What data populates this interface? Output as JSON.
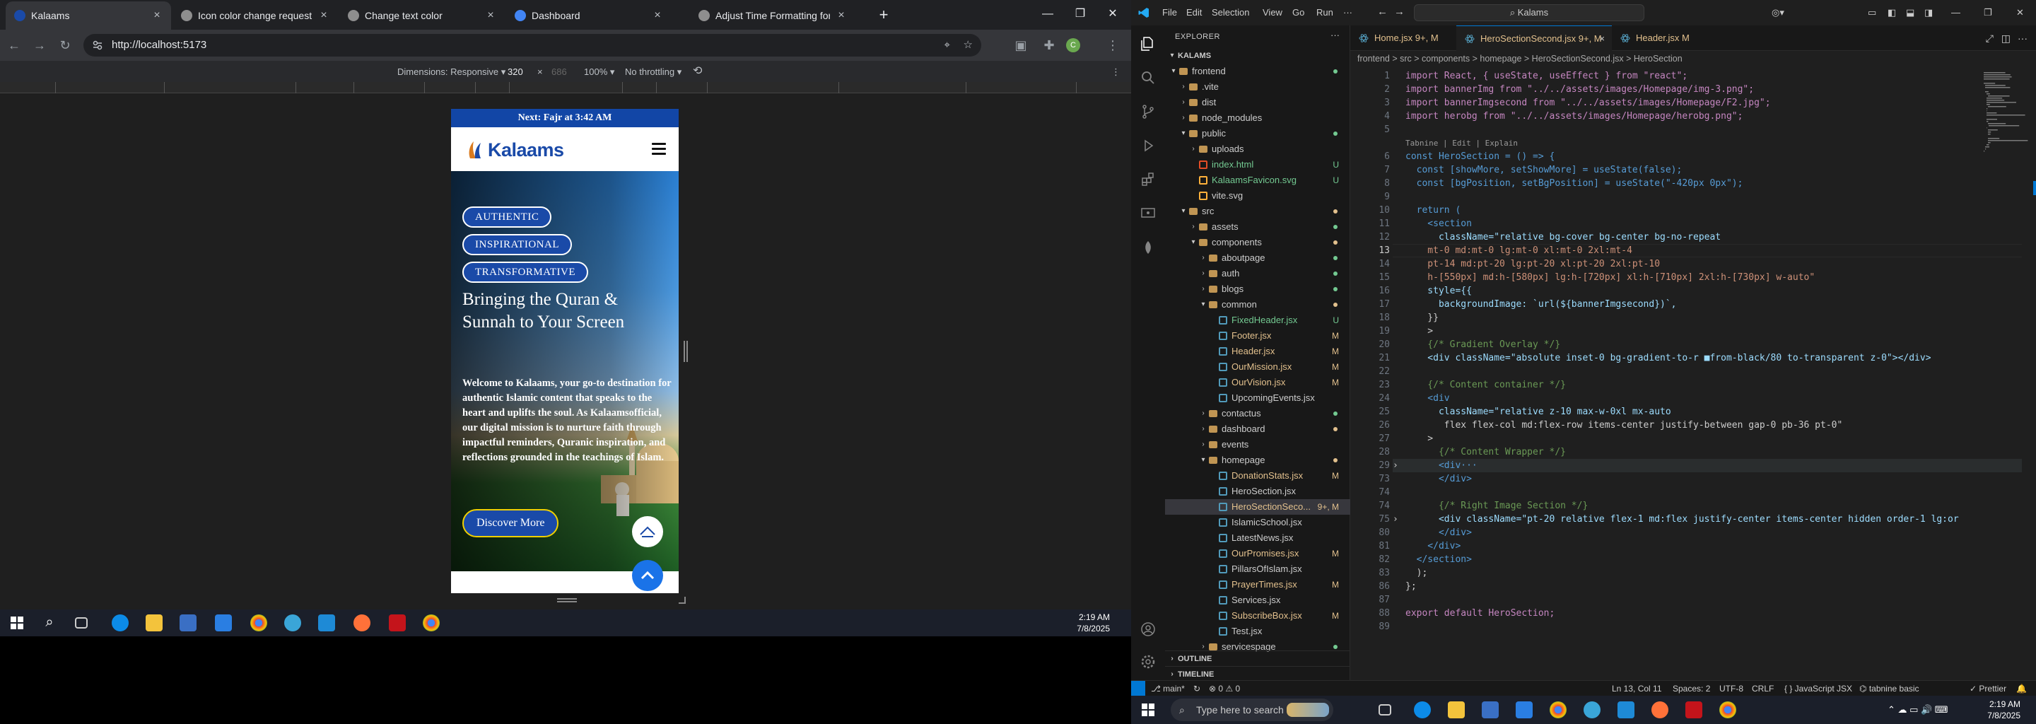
{
  "browser": {
    "tabs": [
      {
        "label": "Kalaams",
        "color": "#1a4aa8"
      },
      {
        "label": "Icon color change request",
        "color": "#8e8e8e"
      },
      {
        "label": "Change text color",
        "color": "#8e8e8e"
      },
      {
        "label": "Dashboard",
        "color": "#4285f4"
      },
      {
        "label": "Adjust Time Formatting for AM",
        "color": "#8e8e8e"
      }
    ],
    "new_tab": "+",
    "url": "http://localhost:5173",
    "devtools": {
      "dimensions_label": "Dimensions: Responsive",
      "width": "320",
      "times": "×",
      "height": "686",
      "zoom": "100%",
      "throttle": "No throttling"
    }
  },
  "site": {
    "prayer_bar": "Next: Fajr at 3:42 AM",
    "logo_text": "Kalaams",
    "pills": [
      "AUTHENTIC",
      "INSPIRATIONAL",
      "TRANSFORMATIVE"
    ],
    "title_line1": "Bringing the Quran &",
    "title_line2": "Sunnah to Your Screen",
    "body": "Welcome to Kalaams, your go-to destination for authentic Islamic content that speaks to the heart and uplifts the soul. As Kalaamsofficial, our digital mission is to nurture faith through impactful reminders, Quranic inspiration, and reflections grounded in the teachings of Islam.",
    "cta": "Discover More"
  },
  "left_clock": {
    "time": "2:19 AM",
    "date": "7/8/2025"
  },
  "vscode": {
    "menu": [
      "File",
      "Edit",
      "Selection",
      "View",
      "Go",
      "Run",
      "···"
    ],
    "search": "Kalams",
    "explorer_title": "EXPLORER",
    "root": "KALAMS",
    "tree": [
      {
        "d": 1,
        "t": "folder",
        "open": true,
        "name": "frontend",
        "dot": "#73c991"
      },
      {
        "d": 2,
        "t": "folder",
        "open": false,
        "name": ".vite"
      },
      {
        "d": 2,
        "t": "folder",
        "open": false,
        "name": "dist"
      },
      {
        "d": 2,
        "t": "folder",
        "open": false,
        "name": "node_modules"
      },
      {
        "d": 2,
        "t": "folder",
        "open": true,
        "name": "public",
        "dot": "#73c991"
      },
      {
        "d": 3,
        "t": "folder",
        "open": false,
        "name": "uploads"
      },
      {
        "d": 3,
        "t": "file",
        "c": "#e44d26",
        "name": "index.html",
        "st": "U"
      },
      {
        "d": 3,
        "t": "file",
        "c": "#ffb13b",
        "name": "KalaamsFavicon.svg",
        "st": "U"
      },
      {
        "d": 3,
        "t": "file",
        "c": "#ffb13b",
        "name": "vite.svg"
      },
      {
        "d": 2,
        "t": "folder",
        "open": true,
        "name": "src",
        "dot": "#e2c08d"
      },
      {
        "d": 3,
        "t": "folder",
        "open": false,
        "name": "assets",
        "dot": "#73c991"
      },
      {
        "d": 3,
        "t": "folder",
        "open": true,
        "name": "components",
        "dot": "#e2c08d"
      },
      {
        "d": 4,
        "t": "folder",
        "open": false,
        "name": "aboutpage",
        "dot": "#73c991"
      },
      {
        "d": 4,
        "t": "folder",
        "open": false,
        "name": "auth",
        "dot": "#73c991"
      },
      {
        "d": 4,
        "t": "folder",
        "open": false,
        "name": "blogs",
        "dot": "#73c991"
      },
      {
        "d": 4,
        "t": "folder",
        "open": true,
        "name": "common",
        "dot": "#e2c08d"
      },
      {
        "d": 5,
        "t": "file",
        "c": "#519aba",
        "name": "FixedHeader.jsx",
        "st": "U"
      },
      {
        "d": 5,
        "t": "file",
        "c": "#519aba",
        "name": "Footer.jsx",
        "st": "M"
      },
      {
        "d": 5,
        "t": "file",
        "c": "#519aba",
        "name": "Header.jsx",
        "st": "M"
      },
      {
        "d": 5,
        "t": "file",
        "c": "#519aba",
        "name": "OurMission.jsx",
        "st": "M"
      },
      {
        "d": 5,
        "t": "file",
        "c": "#519aba",
        "name": "OurVision.jsx",
        "st": "M"
      },
      {
        "d": 5,
        "t": "file",
        "c": "#519aba",
        "name": "UpcomingEvents.jsx"
      },
      {
        "d": 4,
        "t": "folder",
        "open": false,
        "name": "contactus",
        "dot": "#73c991"
      },
      {
        "d": 4,
        "t": "folder",
        "open": false,
        "name": "dashboard",
        "dot": "#e2c08d"
      },
      {
        "d": 4,
        "t": "folder",
        "open": false,
        "name": "events"
      },
      {
        "d": 4,
        "t": "folder",
        "open": true,
        "name": "homepage",
        "dot": "#e2c08d"
      },
      {
        "d": 5,
        "t": "file",
        "c": "#519aba",
        "name": "DonationStats.jsx",
        "st": "M"
      },
      {
        "d": 5,
        "t": "file",
        "c": "#519aba",
        "name": "HeroSection.jsx"
      },
      {
        "d": 5,
        "t": "file",
        "c": "#519aba",
        "name": "HeroSectionSeco...",
        "st": "9+, M",
        "sel": true
      },
      {
        "d": 5,
        "t": "file",
        "c": "#519aba",
        "name": "IslamicSchool.jsx"
      },
      {
        "d": 5,
        "t": "file",
        "c": "#519aba",
        "name": "LatestNews.jsx"
      },
      {
        "d": 5,
        "t": "file",
        "c": "#519aba",
        "name": "OurPromises.jsx",
        "st": "M"
      },
      {
        "d": 5,
        "t": "file",
        "c": "#519aba",
        "name": "PillarsOfIslam.jsx"
      },
      {
        "d": 5,
        "t": "file",
        "c": "#519aba",
        "name": "PrayerTimes.jsx",
        "st": "M"
      },
      {
        "d": 5,
        "t": "file",
        "c": "#519aba",
        "name": "Services.jsx"
      },
      {
        "d": 5,
        "t": "file",
        "c": "#519aba",
        "name": "SubscribeBox.jsx",
        "st": "M"
      },
      {
        "d": 5,
        "t": "file",
        "c": "#519aba",
        "name": "Test.jsx"
      },
      {
        "d": 4,
        "t": "folder",
        "open": false,
        "name": "servicespage",
        "dot": "#73c991"
      }
    ],
    "outline": "OUTLINE",
    "timeline": "TIMELINE",
    "editor_tabs": [
      {
        "label": "Home.jsx 9+, M"
      },
      {
        "label": "HeroSectionSecond.jsx 9+, M",
        "active": true,
        "close": "×"
      },
      {
        "label": "Header.jsx M"
      }
    ],
    "breadcrumb": "frontend > src > components > homepage > HeroSectionSecond.jsx > HeroSection",
    "codelens": "Tabnine | Edit | Explain",
    "lines": [
      {
        "n": "1",
        "t": "import React, { useState, useEffect } from \"react\";"
      },
      {
        "n": "2",
        "t": "import bannerImg from \"../../assets/images/Homepage/img-3.png\";"
      },
      {
        "n": "3",
        "t": "import bannerImgsecond from \"../../assets/images/Homepage/F2.jpg\";"
      },
      {
        "n": "4",
        "t": "import herobg from \"../../assets/images/Homepage/herobg.png\";"
      },
      {
        "n": "5",
        "t": ""
      },
      {
        "n": "6",
        "t": "const HeroSection = () => {"
      },
      {
        "n": "7",
        "t": "  const [showMore, setShowMore] = useState(false);"
      },
      {
        "n": "8",
        "t": "  const [bgPosition, setBgPosition] = useState(\"-420px 0px\");"
      },
      {
        "n": "9",
        "t": ""
      },
      {
        "n": "10",
        "t": "  return ("
      },
      {
        "n": "11",
        "t": "    <section"
      },
      {
        "n": "12",
        "t": "      className=\"relative bg-cover bg-center bg-no-repeat"
      },
      {
        "n": "13",
        "t": "    mt-0 md:mt-0 lg:mt-0 xl:mt-0 2xl:mt-4"
      },
      {
        "n": "14",
        "t": "    pt-14 md:pt-20 lg:pt-20 xl:pt-20 2xl:pt-10"
      },
      {
        "n": "15",
        "t": "    h-[550px] md:h-[580px] lg:h-[720px] xl:h-[710px] 2xl:h-[730px] w-auto\""
      },
      {
        "n": "16",
        "t": "    style={{"
      },
      {
        "n": "17",
        "t": "      backgroundImage: `url(${bannerImgsecond})`,"
      },
      {
        "n": "18",
        "t": "    }}"
      },
      {
        "n": "19",
        "t": "    >"
      },
      {
        "n": "20",
        "t": "    {/* Gradient Overlay */}"
      },
      {
        "n": "21",
        "t": "    <div className=\"absolute inset-0 bg-gradient-to-r ■from-black/80 to-transparent z-0\"></div>"
      },
      {
        "n": "22",
        "t": ""
      },
      {
        "n": "23",
        "t": "    {/* Content container */}"
      },
      {
        "n": "24",
        "t": "    <div"
      },
      {
        "n": "25",
        "t": "      className=\"relative z-10 max-w-0xl mx-auto"
      },
      {
        "n": "26",
        "t": "       flex flex-col md:flex-row items-center justify-between gap-0 pb-36 pt-0\""
      },
      {
        "n": "27",
        "t": "    >"
      },
      {
        "n": "28",
        "t": "      {/* Content Wrapper */}"
      },
      {
        "n": "29",
        "t": "      <div···"
      },
      {
        "n": "73",
        "t": "      </div>"
      },
      {
        "n": "74",
        "t": ""
      },
      {
        "n": "74",
        "t": "      {/* Right Image Section */}"
      },
      {
        "n": "75",
        "t": "      <div className=\"pt-20 relative flex-1 md:flex justify-center items-center hidden order-1 lg:or"
      },
      {
        "n": "80",
        "t": "      </div>"
      },
      {
        "n": "81",
        "t": "    </div>"
      },
      {
        "n": "82",
        "t": "  </section>"
      },
      {
        "n": "83",
        "t": "  );"
      },
      {
        "n": "86",
        "t": "};"
      },
      {
        "n": "87",
        "t": ""
      },
      {
        "n": "88",
        "t": "export default HeroSection;"
      },
      {
        "n": "89",
        "t": ""
      }
    ],
    "status": {
      "branch": "main*",
      "sync": "↻",
      "errors": "⊗ 0 ⚠ 0",
      "position": "Ln 13, Col 11",
      "spaces": "Spaces: 2",
      "encoding": "UTF-8",
      "eol": "CRLF",
      "language": "{ } JavaScript JSX",
      "tabnine": "tabnine basic",
      "prettier": "✓ Prettier"
    }
  },
  "right_task": {
    "search": "Type here to search",
    "time": "2:19 AM",
    "date": "7/8/2025"
  }
}
